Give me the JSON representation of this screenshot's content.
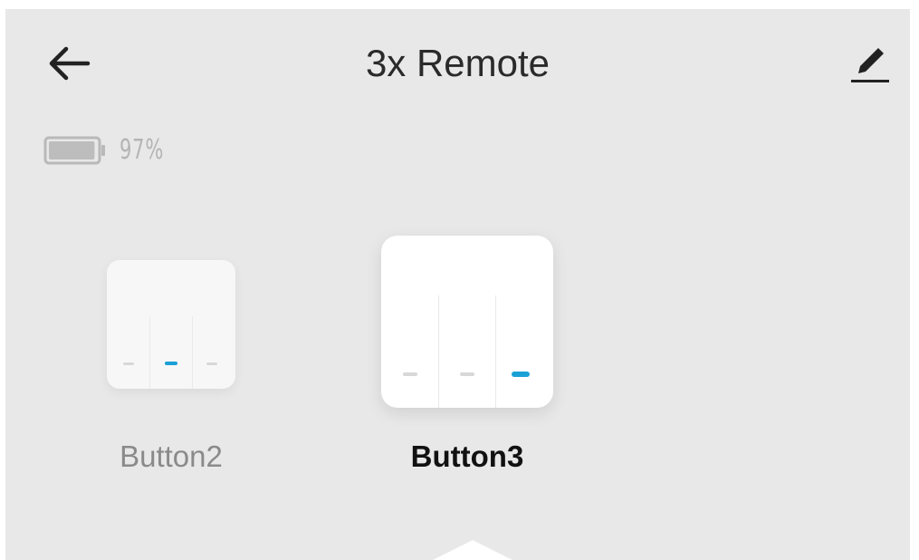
{
  "header": {
    "title": "3x Remote",
    "back_icon": "arrow-left-icon",
    "edit_icon": "pencil-icon"
  },
  "battery": {
    "icon": "battery-icon",
    "percent_text": "97%",
    "level": 0.97
  },
  "buttons": [
    {
      "label": "Button2",
      "selected": false,
      "active_indicator": 2
    },
    {
      "label": "Button3",
      "selected": true,
      "active_indicator": 3
    }
  ],
  "colors": {
    "background": "#e8e8e8",
    "accent": "#1aa0d6",
    "inactive_indicator": "#d8d8d8",
    "panel": "#ffffff"
  }
}
